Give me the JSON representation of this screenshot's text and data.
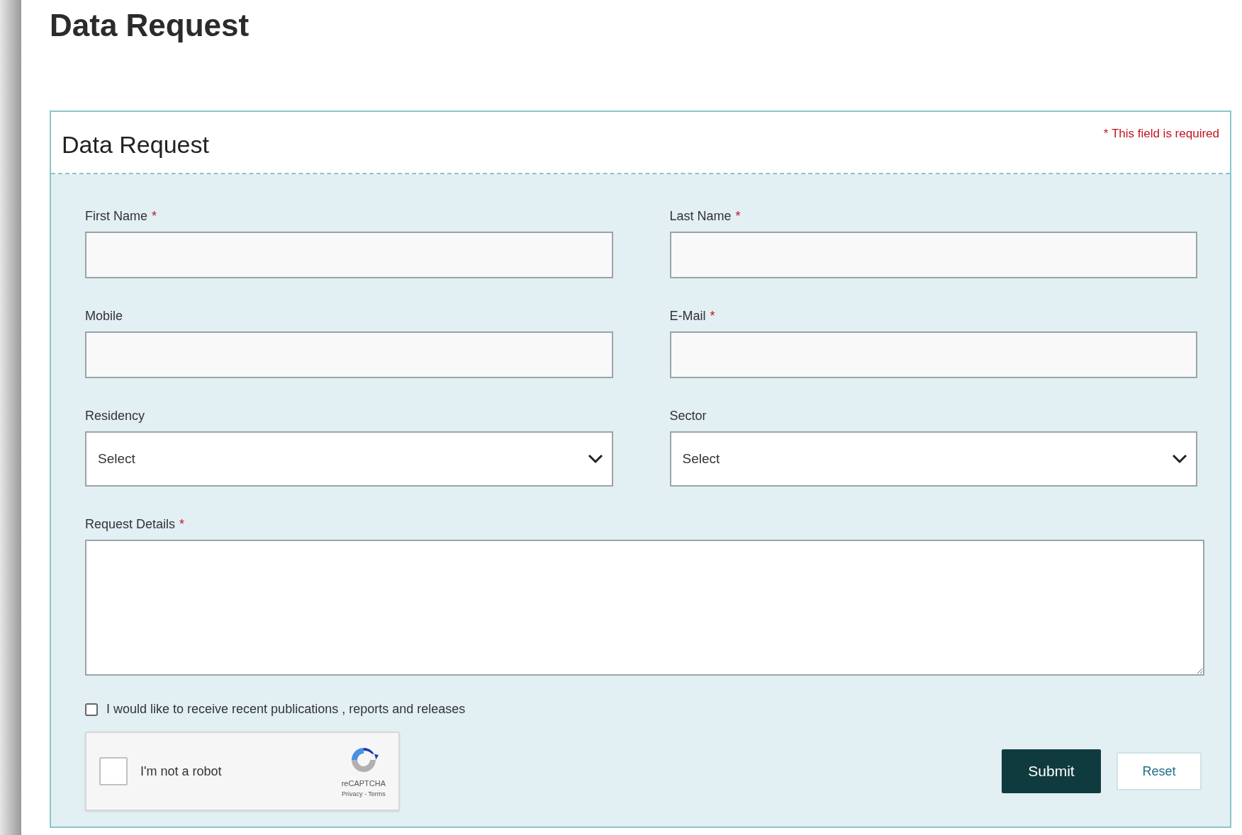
{
  "page_title": "Data Request",
  "form": {
    "title": "Data Request",
    "required_note": "* This field is required",
    "fields": [
      {
        "kind": "text",
        "label": "First Name",
        "required_mark": "*"
      },
      {
        "kind": "text",
        "label": "Last Name",
        "required_mark": "*"
      },
      {
        "kind": "text",
        "label": "Mobile"
      },
      {
        "kind": "text",
        "label": "E-Mail",
        "required_mark": "*"
      },
      {
        "kind": "select",
        "label": "Residency",
        "value": "Select"
      },
      {
        "kind": "select",
        "label": "Sector",
        "value": "Select"
      },
      {
        "kind": "textarea",
        "label": "Request Details",
        "required_mark": "*"
      }
    ],
    "subscribe": {
      "label": "I would like to receive recent publications , reports and releases",
      "checked": false
    },
    "captcha": {
      "label": "I'm not a robot",
      "checked": false,
      "brand": "reCAPTCHA",
      "links": "Privacy - Terms"
    },
    "buttons": [
      {
        "kind": "primary",
        "label": "Submit"
      },
      {
        "kind": "secondary",
        "label": "Reset"
      }
    ]
  }
}
